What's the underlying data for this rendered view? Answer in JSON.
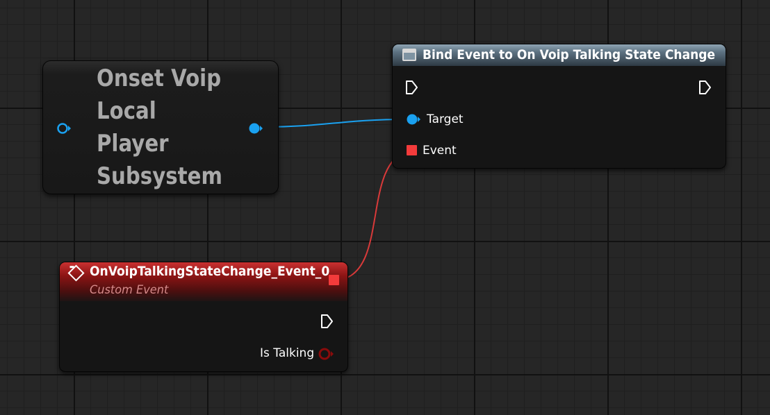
{
  "colors": {
    "canvas_background": "#262626",
    "object_pin": "#1aa1f0",
    "delegate_pin": "#f33b3b",
    "boolean_pin": "#8a0b0b",
    "bind_header": "#5d7282",
    "event_header": "#8b1414"
  },
  "compact_node": {
    "title": "Onset Voip\nLocal\nPlayer\nSubsystem",
    "input_pin_icon": "object-pin-icon",
    "output_pin_icon": "object-pin-icon"
  },
  "bind_node": {
    "title": "Bind Event to On Voip Talking State Change",
    "icon": "function-icon",
    "pins": {
      "exec_in": "exec-pin-icon",
      "exec_out": "exec-pin-icon",
      "target_label": "Target",
      "event_label": "Event"
    }
  },
  "event_node": {
    "title": "OnVoipTalkingStateChange_Event_0",
    "subtitle": "Custom Event",
    "icon": "event-icon",
    "pins": {
      "delegate_out": "delegate-pin-icon",
      "exec_out": "exec-pin-icon",
      "is_talking_label": "Is Talking"
    }
  }
}
